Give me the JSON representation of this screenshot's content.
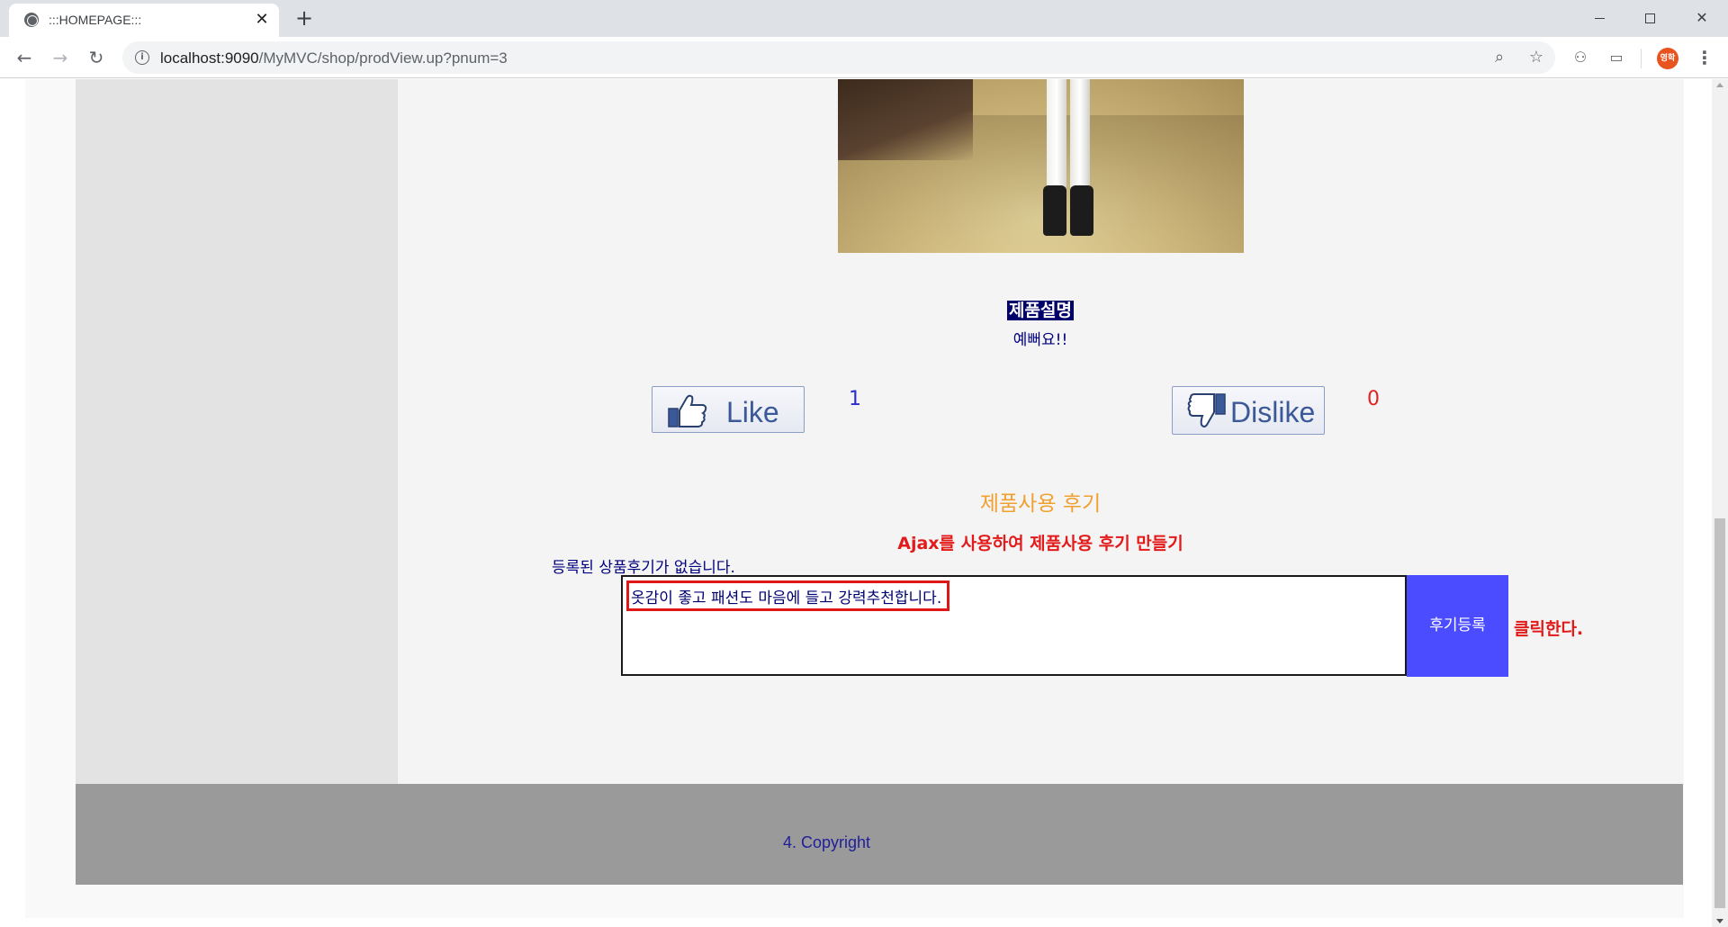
{
  "browser": {
    "tab_title": ":::HOMEPAGE:::",
    "tab_close": "✕",
    "new_tab": "+",
    "url_host": "localhost:9090",
    "url_path": "/MyMVC/shop/prodView.up?pnum=3",
    "profile_label": "영학"
  },
  "product": {
    "description_title": "제품설명",
    "description_text": "예뻐요!!"
  },
  "reactions": {
    "like_label": "Like",
    "like_count": "1",
    "dislike_label": "Dislike",
    "dislike_count": "0"
  },
  "review": {
    "heading": "제품사용 후기",
    "ajax_note": "Ajax를 사용하여 제품사용 후기 만들기",
    "no_reviews": "등록된 상품후기가 없습니다.",
    "input_value": "옷감이 좋고 패션도 마음에 들고 강력추천합니다.",
    "submit_label": "후기등록",
    "click_note": "클릭한다."
  },
  "footer": {
    "copyright": "4. Copyright"
  },
  "colors": {
    "accent_blue": "#4b4bff",
    "annotation_red": "#e21a1a",
    "heading_orange": "#f0a030",
    "footer_gray": "#9a9a9a"
  }
}
